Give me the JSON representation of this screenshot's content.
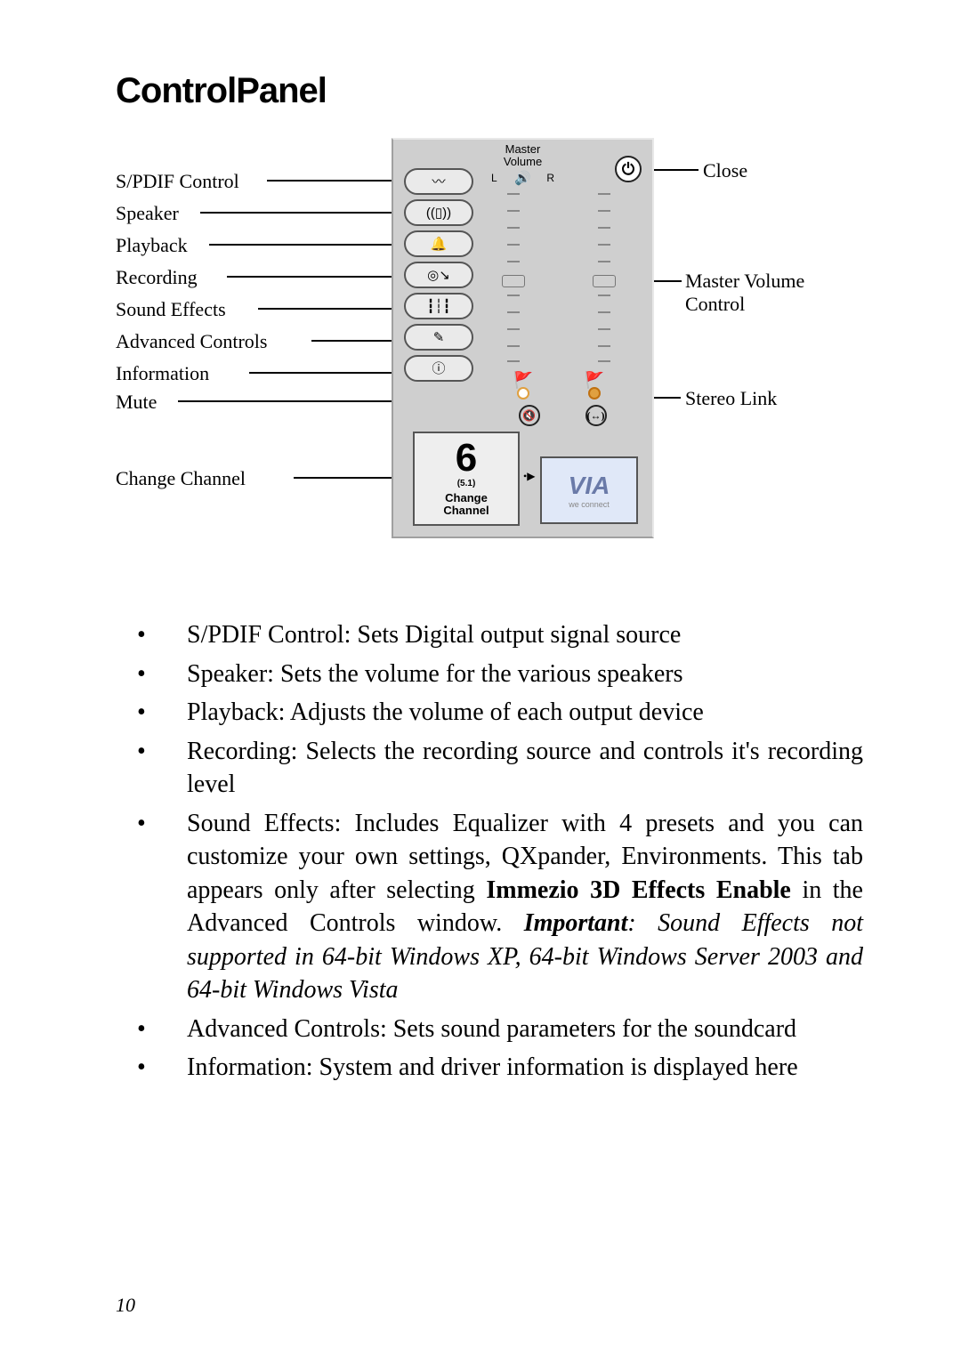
{
  "heading": "ControlPanel",
  "panel": {
    "master_volume_label": "Master\nVolume",
    "l": "L",
    "r": "R",
    "change_channel_label": "Change\nChannel",
    "six": "6",
    "five_one": "(5.1)",
    "via_logo": "VIA",
    "via_sub": "we connect"
  },
  "callouts": {
    "spdif": "S/PDIF Control",
    "speaker": "Speaker",
    "playback": "Playback",
    "recording": "Recording",
    "sound_effects": "Sound Effects",
    "advanced_controls": "Advanced Controls",
    "information": "Information",
    "mute": "Mute",
    "change_channel": "Change Channel",
    "close": "Close",
    "master_volume_control": "Master Volume\nControl",
    "stereo_link": "Stereo Link"
  },
  "bullets": {
    "b1": "S/PDIF Control: Sets Digital output signal source",
    "b2": "Speaker: Sets the volume for the various speakers",
    "b3": "Playback: Adjusts the volume of each output device",
    "b4_a": "Recording: Selects the recording source and controls it's recording level",
    "b5_a": "Sound Effects: Includes Equalizer with 4 presets and you can customize your own settings, QXpander, Environments.  This tab appears only after selecting ",
    "b5_b": "Immezio 3D Effects Enable",
    "b5_c": " in the Advanced Controls window.  ",
    "b5_d": "Important",
    "b5_e": ": Sound Effects not supported in  64-bit Windows XP,  64-bit Windows Server 2003 and 64-bit Windows Vista",
    "b6": "Advanced Controls: Sets sound parameters for the soundcard",
    "b7": "Information: System and driver information is displayed here"
  },
  "page_number": "10"
}
